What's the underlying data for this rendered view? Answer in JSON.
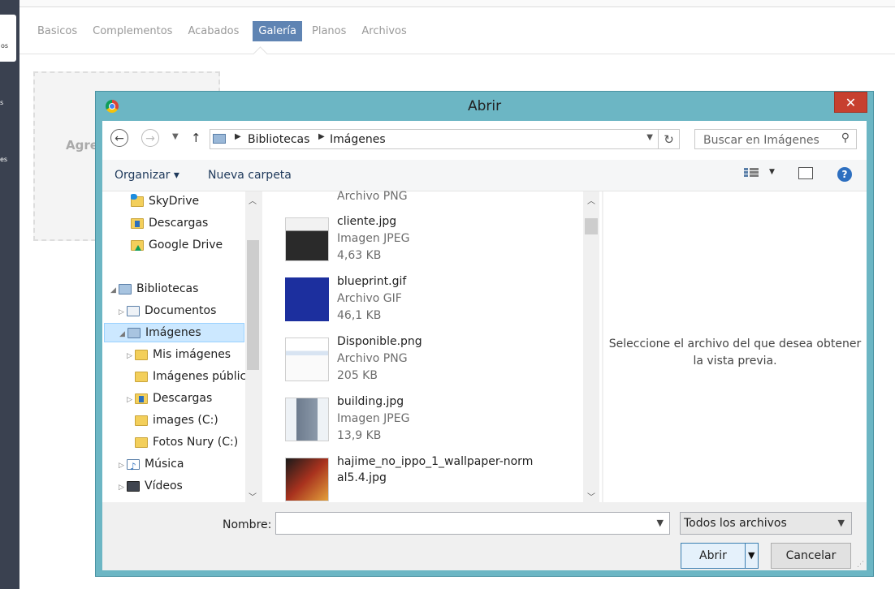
{
  "background": {
    "tabs": [
      "Basicos",
      "Complementos",
      "Acabados",
      "Galería",
      "Planos",
      "Archivos"
    ],
    "active_tab_index": 3,
    "drop_zone_label": "Agre",
    "rail_labels": [
      "os",
      "s",
      "es"
    ],
    "accent_color": "#5f84b3"
  },
  "dialog": {
    "title": "Abrir",
    "close_label": "✕",
    "address": {
      "crumbs": [
        "Bibliotecas",
        "Imágenes"
      ]
    },
    "search_placeholder": "Buscar en Imágenes",
    "toolbar": {
      "organize_label": "Organizar ▾",
      "new_folder_label": "Nueva carpeta",
      "help_label": "?"
    },
    "nav_tree": [
      {
        "label": "SkyDrive",
        "icon": "skydrive-folder-icon"
      },
      {
        "label": "Descargas",
        "icon": "downloads-folder-icon"
      },
      {
        "label": "Google Drive",
        "icon": "google-drive-folder-icon"
      },
      {
        "label": "Bibliotecas",
        "icon": "libraries-icon"
      },
      {
        "label": "Documentos",
        "icon": "documents-library-icon"
      },
      {
        "label": "Imágenes",
        "icon": "pictures-library-icon"
      },
      {
        "label": "Mis imágenes",
        "icon": "folder-icon"
      },
      {
        "label": "Imágenes públic",
        "icon": "folder-icon"
      },
      {
        "label": "Descargas",
        "icon": "downloads-folder-icon"
      },
      {
        "label": "images (C:)",
        "icon": "folder-icon"
      },
      {
        "label": "Fotos Nury (C:)",
        "icon": "folder-icon"
      },
      {
        "label": "Música",
        "icon": "music-library-icon"
      },
      {
        "label": "Vídeos",
        "icon": "videos-library-icon"
      }
    ],
    "selected_nav": "Imágenes",
    "partial_top_type": "Archivo PNG",
    "files": [
      {
        "name": "cliente.jpg",
        "type": "Imagen JPEG",
        "size": "4,63 KB"
      },
      {
        "name": "blueprint.gif",
        "type": "Archivo GIF",
        "size": "46,1 KB"
      },
      {
        "name": "Disponible.png",
        "type": "Archivo PNG",
        "size": "205 KB"
      },
      {
        "name": "building.jpg",
        "type": "Imagen JPEG",
        "size": "13,9 KB"
      },
      {
        "name": "hajime_no_ippo_1_wallpaper-norm",
        "name2": "al5.4.jpg"
      }
    ],
    "preview_text": "Seleccione el archivo del que desea obtener la vista previa.",
    "filename_label": "Nombre:",
    "filename_value": "",
    "filter_value": "Todos los archivos",
    "open_label": "Abrir",
    "cancel_label": "Cancelar"
  }
}
